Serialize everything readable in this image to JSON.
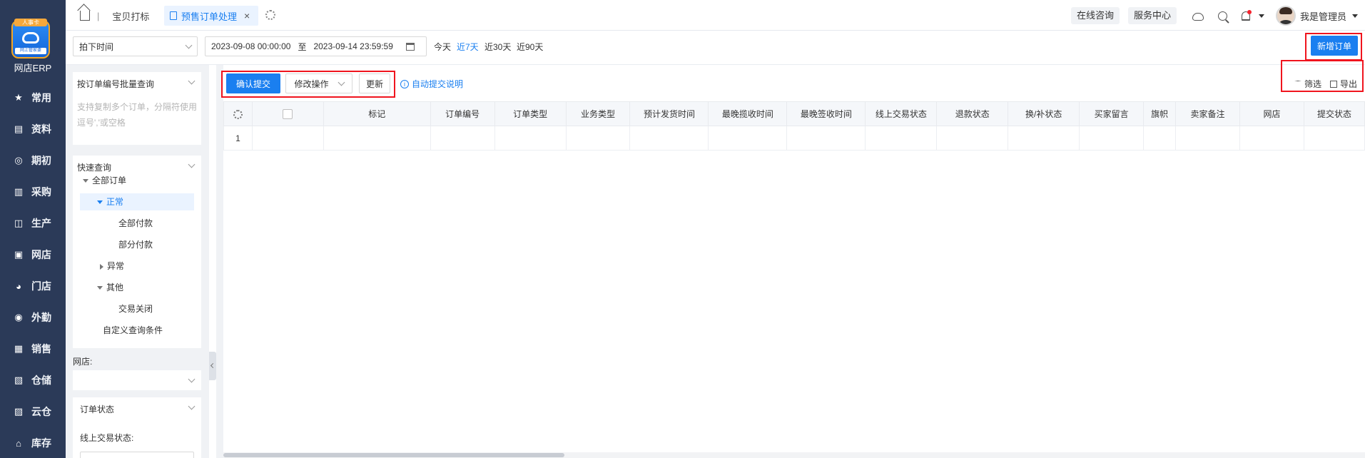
{
  "nav": {
    "logo_ribbon": "人事卡",
    "logo_sub": "网上管家婆",
    "brand": "网店ERP",
    "items": [
      {
        "label": "常用",
        "icon": "star-icon"
      },
      {
        "label": "资料",
        "icon": "document-icon"
      },
      {
        "label": "期初",
        "icon": "target-icon"
      },
      {
        "label": "采购",
        "icon": "purchase-icon"
      },
      {
        "label": "生产",
        "icon": "production-icon"
      },
      {
        "label": "网店",
        "icon": "store-icon"
      },
      {
        "label": "门店",
        "icon": "pie-icon"
      },
      {
        "label": "外勤",
        "icon": "field-icon"
      },
      {
        "label": "销售",
        "icon": "sales-icon"
      },
      {
        "label": "仓储",
        "icon": "warehouse-icon"
      },
      {
        "label": "云仓",
        "icon": "cloud-warehouse-icon"
      },
      {
        "label": "库存",
        "icon": "inventory-icon"
      }
    ]
  },
  "topbar": {
    "tab_home_sep": "|",
    "tab_print": "宝贝打标",
    "tab_active": "预售订单处理",
    "tab_close": "×",
    "online_consult": "在线咨询",
    "service_center": "服务中心",
    "user_name": "我是管理员"
  },
  "filter": {
    "date_type": "拍下时间",
    "date_start": "2023-09-08 00:00:00",
    "date_to": "至",
    "date_end": "2023-09-14 23:59:59",
    "quick_today": "今天",
    "quick_7": "近7天",
    "quick_30": "近30天",
    "quick_90": "近90天",
    "new_order": "新增订单",
    "link_color": "#1a7ff0"
  },
  "panel": {
    "batch_title": "按订单编号批量查询",
    "batch_placeholder": "支持复制多个订单，分隔符使用逗号','或空格",
    "quick_title": "快速查询",
    "tree_all": "全部订单",
    "tree_normal": "正常",
    "tree_all_paid": "全部付款",
    "tree_partial_paid": "部分付款",
    "tree_abnormal": "异常",
    "tree_other": "其他",
    "tree_closed": "交易关闭",
    "tree_custom": "自定义查询条件",
    "shop_label": "网店:",
    "order_status_title": "订单状态",
    "online_status_label": "线上交易状态:"
  },
  "actions": {
    "confirm_submit": "确认提交",
    "modify_ops": "修改操作",
    "update": "更新",
    "auto_submit_info": "自动提交说明",
    "filter": "筛选",
    "export": "导出"
  },
  "table": {
    "columns": [
      "标记",
      "订单编号",
      "订单类型",
      "业务类型",
      "预计发货时间",
      "最晚揽收时间",
      "最晚签收时间",
      "线上交易状态",
      "退款状态",
      "换/补状态",
      "买家留言",
      "旗帜",
      "卖家备注",
      "网店",
      "提交状态"
    ],
    "rows": [
      {
        "index": "1"
      }
    ]
  }
}
